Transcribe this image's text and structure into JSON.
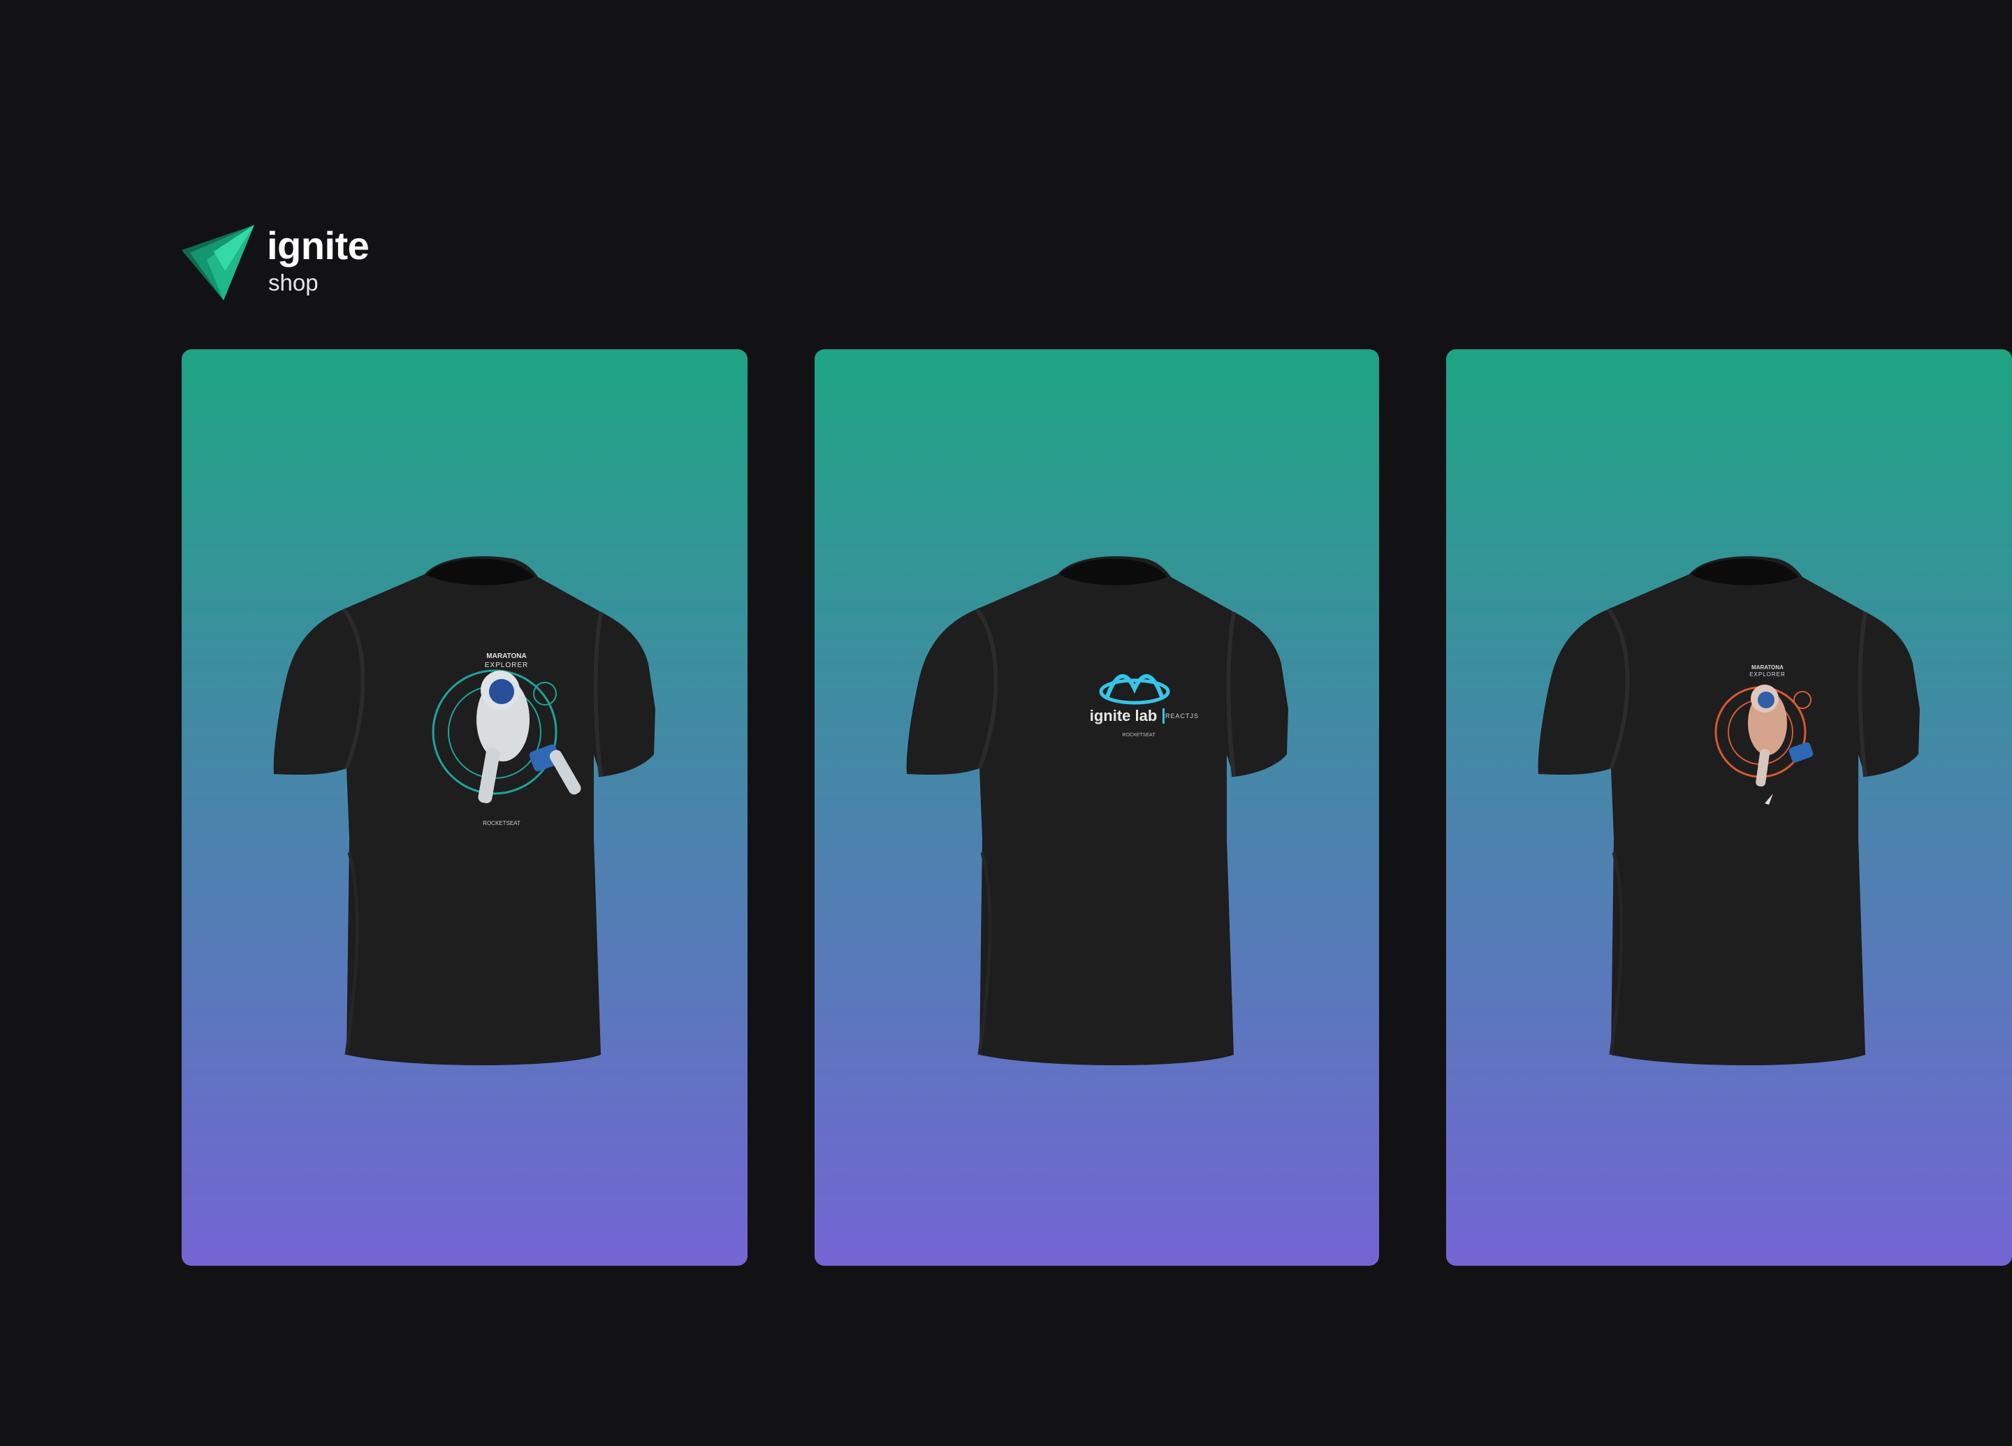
{
  "header": {
    "logo_word": "ignite",
    "logo_sub": "shop",
    "logo_colors": {
      "dark": "#0f6b4f",
      "mid": "#16a37c",
      "light": "#2fd8a4"
    }
  },
  "products": [
    {
      "print": "astronaut-print",
      "print_title": "MARATONA",
      "print_subtitle": "EXPLORER",
      "print_footer": "ROCKETSEAT",
      "accent": "#2bd0b6"
    },
    {
      "print": "ignite-lab-print",
      "print_title": "ignite lab",
      "print_subtitle": "REACTJS",
      "print_footer": "ROCKETSEAT",
      "accent": "#38c4e8"
    },
    {
      "print": "astronaut-print",
      "print_title": "MARATONA",
      "print_subtitle": "EXPLORER",
      "print_footer": "",
      "accent": "#e06a3a"
    }
  ],
  "theme": {
    "background": "#121214",
    "card_gradient_top": "#1ea483",
    "card_gradient_bottom": "#7465d4",
    "shirt_color": "#1e1e1f"
  }
}
